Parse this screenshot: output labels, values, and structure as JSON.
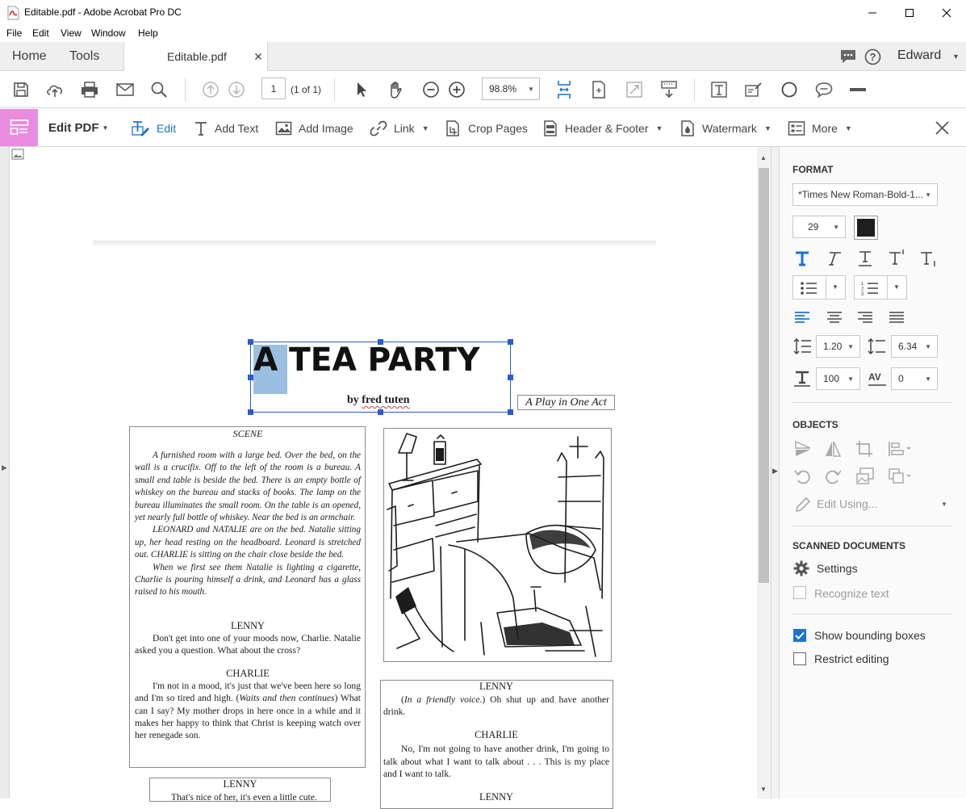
{
  "window": {
    "title": "Editable.pdf - Adobe Acrobat Pro DC",
    "minimize": "—",
    "maximize": "☐",
    "close": "✕"
  },
  "menu": [
    "File",
    "Edit",
    "View",
    "Window",
    "Help"
  ],
  "tabs": {
    "home": "Home",
    "tools": "Tools",
    "document": "Editable.pdf",
    "user": "Edward"
  },
  "toolbar": {
    "page_number": "1",
    "page_count": "(1 of 1)",
    "zoom": "98.8%"
  },
  "editbar": {
    "title": "Edit PDF",
    "edit": "Edit",
    "add_text": "Add Text",
    "add_image": "Add Image",
    "link": "Link",
    "crop_pages": "Crop Pages",
    "header_footer": "Header & Footer",
    "watermark": "Watermark",
    "more": "More"
  },
  "format_panel": {
    "section": "FORMAT",
    "font": "*Times New Roman-Bold-1...",
    "font_size": "29",
    "line_spacing": "1.20",
    "paragraph_spacing": "6.34",
    "horizontal_scaling": "100",
    "character_spacing": "0",
    "text_color": "#1e1e1e"
  },
  "objects_panel": {
    "section": "OBJECTS",
    "edit_using": "Edit Using..."
  },
  "scanned_panel": {
    "section": "SCANNED DOCUMENTS",
    "settings": "Settings",
    "recognize": "Recognize text"
  },
  "options": {
    "show_bounding": "Show bounding boxes",
    "show_bounding_checked": true,
    "restrict_editing": "Restrict editing",
    "restrict_editing_checked": false
  },
  "page": {
    "title_highlight": "A",
    "title_rest": " TEA PARTY",
    "byline_prefix": "by ",
    "byline_name": "fred tuten",
    "subtitle": "A Play in One Act",
    "scene_head": "SCENE",
    "scene_p1": "A furnished room with a large bed. Over the bed, on the wall is a crucifix. Off to the left of the room is a bureau. A small end table is beside the bed. There is an empty bottle of whiskey on the bureau and stacks of books. The lamp on the bureau illuminates the small room. On the table is an opened, yet nearly full bottle of whiskey. Near the bed is an armchair.",
    "scene_p2": "LEONARD and NATALIE are on the bed. Natalie sitting up, her head resting on the headboard. Leonard is stretched out. CHARLIE is sitting on the chair close beside the bed.",
    "scene_p3": "When we first see them Natalie is lighting a cigarette, Charlie is pouring himself a drink, and Leonard has a glass raised to his mouth.",
    "lenny_1": "LENNY",
    "lenny_1_line": "Don't get into one of your moods now, Charlie.  Natalie asked you a question. What about the cross?",
    "charlie_1": "CHARLIE",
    "charlie_1_a": "I'm not in a mood, it's just that we've been here so long and I'm so tired and high. (",
    "charlie_1_dir": "Waits and then continues",
    "charlie_1_b": ") What can I say? My mother drops in here once in a while and it makes her happy to think that Christ is keeping watch over her renegade son.",
    "lenny_2": "LENNY",
    "lenny_2_line": "That's nice of her, it's even a little cute.",
    "lenny_3": "LENNY",
    "lenny_3_a": "(",
    "lenny_3_dir": "In a friendly voice.",
    "lenny_3_b": ") Oh shut up and have another drink.",
    "charlie_2": "CHARLIE",
    "charlie_2_line": "No, I'm not going to have another drink, I'm going to talk about what I want to talk about . . . This is my place and I want to talk.",
    "lenny_4": "LENNY"
  }
}
